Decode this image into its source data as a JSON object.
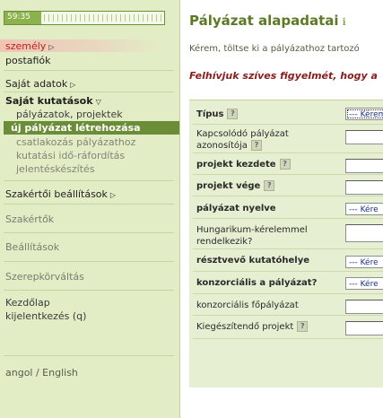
{
  "session": {
    "timer": "59:35",
    "progress_fraction": 0.23
  },
  "sidebar": {
    "person": "személy",
    "mailbox": "postafiók",
    "my_data": "Saját adatok",
    "my_research": "Saját kutatások",
    "research_items": {
      "projects": "pályázatok, projektek",
      "new_proposal": "új pályázat létrehozása",
      "join": "csatlakozás pályázathoz",
      "time_spend": "kutatási idő-ráfordítás",
      "reporting": "jelentéskészítés"
    },
    "expert_settings": "Szakértői beállítások",
    "experts": "Szakértők",
    "settings": "Beállítások",
    "role_switch": "Szerepkörváltás",
    "home": "Kezdőlap",
    "logout": "kijelentkezés (q)",
    "language": "angol / English"
  },
  "main": {
    "title": "Pályázat alapadatai",
    "intro": "Kérem, töltse ki a pályázathoz tartozó",
    "warning": "Felhívjuk szíves figyelmét, hogy a"
  },
  "form": {
    "type_label": "Típus",
    "type_value": "--- Kérem",
    "related_line1": "Kapcsolódó pályázat",
    "related_line2": "azonosítója",
    "start_label": "projekt kezdete",
    "end_label": "projekt vége",
    "language_label": "pályázat nyelve",
    "language_value": "--- Kére",
    "hungarian_line1": "Hungarikum-kérelemmel",
    "hungarian_line2": "rendelkezik?",
    "place_label": "résztvevő kutatóhelye",
    "place_value": "--- Kére",
    "consortium_label": "konzorciális a pályázat?",
    "consortium_value": "--- Kére",
    "main_proposal_label": "konzorciális főpályázat",
    "supplement_label": "Kiegészítendő projekt",
    "help_mark": "?"
  },
  "colors": {
    "accent_green": "#5c7a24",
    "warning_red": "#8a1c1c",
    "sidebar_bg": "#e3edc5"
  }
}
